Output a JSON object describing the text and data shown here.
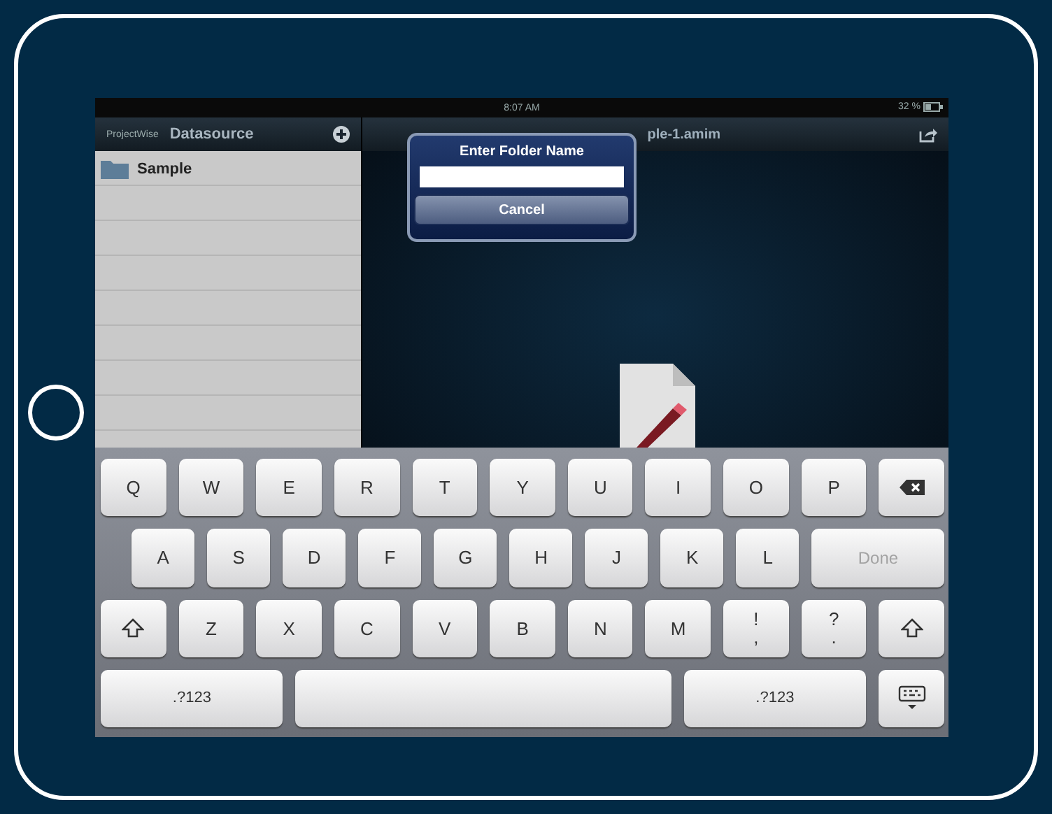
{
  "status_bar": {
    "time": "8:07 AM",
    "battery": "32 %"
  },
  "sidebar": {
    "brand": "ProjectWise",
    "title": "Datasource",
    "items": [
      {
        "label": "Sample"
      }
    ]
  },
  "detail": {
    "title": "ple-1.amim"
  },
  "dialog": {
    "title": "Enter Folder Name",
    "button": "Cancel"
  },
  "keyboard": {
    "rows": [
      [
        {
          "kind": "key",
          "label": "Q"
        },
        {
          "kind": "key",
          "label": "W"
        },
        {
          "kind": "key",
          "label": "E"
        },
        {
          "kind": "key",
          "label": "R"
        },
        {
          "kind": "key",
          "label": "T"
        },
        {
          "kind": "key",
          "label": "Y"
        },
        {
          "kind": "key",
          "label": "U"
        },
        {
          "kind": "key",
          "label": "I"
        },
        {
          "kind": "key",
          "label": "O"
        },
        {
          "kind": "key",
          "label": "P"
        },
        {
          "kind": "backspace"
        }
      ],
      [
        {
          "kind": "key",
          "label": "A"
        },
        {
          "kind": "key",
          "label": "S"
        },
        {
          "kind": "key",
          "label": "D"
        },
        {
          "kind": "key",
          "label": "F"
        },
        {
          "kind": "key",
          "label": "G"
        },
        {
          "kind": "key",
          "label": "H"
        },
        {
          "kind": "key",
          "label": "J"
        },
        {
          "kind": "key",
          "label": "K"
        },
        {
          "kind": "key",
          "label": "L"
        },
        {
          "kind": "done",
          "label": "Done"
        }
      ],
      [
        {
          "kind": "shift"
        },
        {
          "kind": "key",
          "label": "Z"
        },
        {
          "kind": "key",
          "label": "X"
        },
        {
          "kind": "key",
          "label": "C"
        },
        {
          "kind": "key",
          "label": "V"
        },
        {
          "kind": "key",
          "label": "B"
        },
        {
          "kind": "key",
          "label": "N"
        },
        {
          "kind": "key",
          "label": "M"
        },
        {
          "kind": "dual",
          "top": "!",
          "bottom": ","
        },
        {
          "kind": "dual",
          "top": "?",
          "bottom": "."
        },
        {
          "kind": "shift"
        }
      ],
      [
        {
          "kind": "mode",
          "label": ".?123"
        },
        {
          "kind": "space"
        },
        {
          "kind": "mode",
          "label": ".?123"
        },
        {
          "kind": "dismiss"
        }
      ]
    ]
  }
}
